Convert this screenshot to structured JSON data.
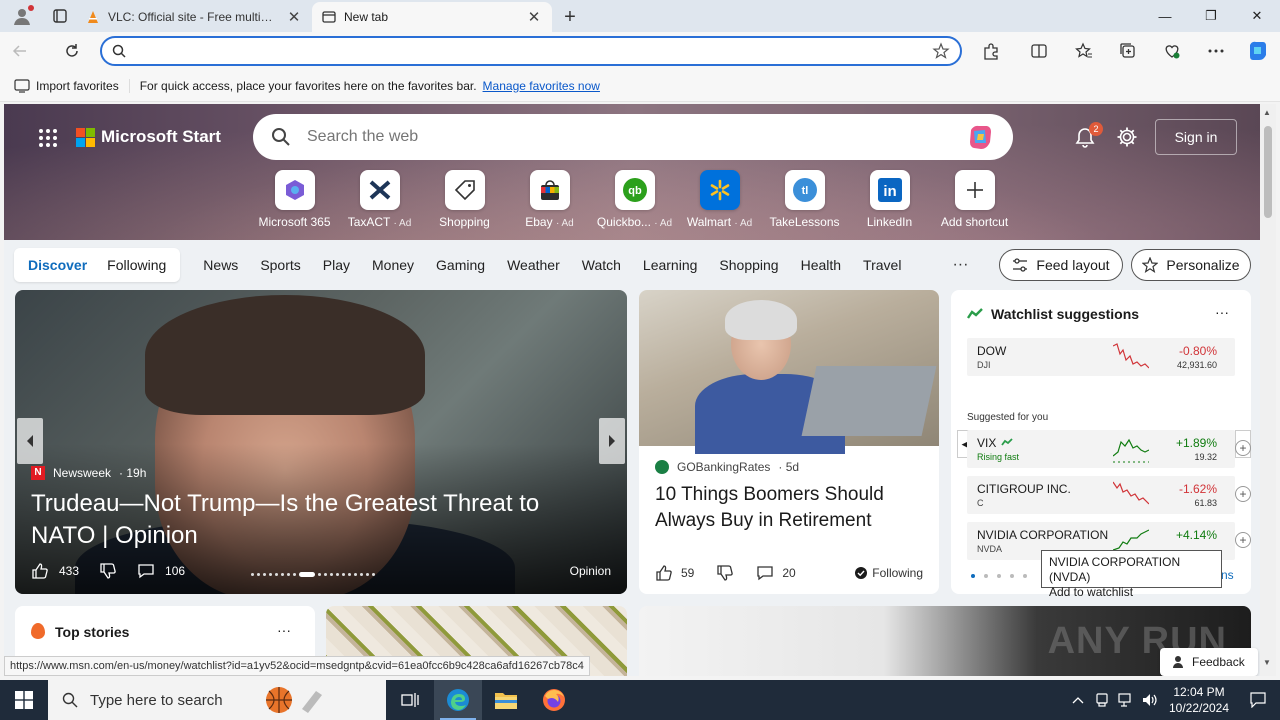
{
  "browser": {
    "tabs": [
      {
        "title": "VLC: Official site - Free multimedia solutions for all OS!",
        "close": "✕"
      },
      {
        "title": "New tab",
        "close": "✕"
      }
    ],
    "new_tab": "+",
    "address_placeholder": "",
    "window_controls": {
      "minimize": "—",
      "maximize": "❐",
      "close": "✕"
    }
  },
  "favorites_bar": {
    "import_label": "Import favorites",
    "message": "For quick access, place your favorites here on the favorites bar.",
    "link": "Manage favorites now"
  },
  "msstart": {
    "brand": "Microsoft Start",
    "search_placeholder": "Search the web",
    "notification_count": "2",
    "sign_in": "Sign in",
    "shortcuts": [
      {
        "label": "Microsoft 365",
        "ad": ""
      },
      {
        "label": "TaxACT",
        "ad": "· Ad"
      },
      {
        "label": "Shopping",
        "ad": ""
      },
      {
        "label": "Ebay",
        "ad": "· Ad"
      },
      {
        "label": "Quickbo...",
        "ad": "· Ad"
      },
      {
        "label": "Walmart",
        "ad": "· Ad"
      },
      {
        "label": "TakeLessons",
        "ad": ""
      },
      {
        "label": "LinkedIn",
        "ad": ""
      },
      {
        "label": "Add shortcut",
        "ad": ""
      }
    ]
  },
  "nav": {
    "pill": [
      "Discover",
      "Following"
    ],
    "categories": [
      "News",
      "Sports",
      "Play",
      "Money",
      "Gaming",
      "Weather",
      "Watch",
      "Learning",
      "Shopping",
      "Health",
      "Travel"
    ],
    "more": "···",
    "feed_layout": "Feed layout",
    "personalize": "Personalize"
  },
  "main_story": {
    "source": "Newsweek",
    "age": "· 19h",
    "headline": "Trudeau—Not Trump—Is the Greatest Threat to NATO | Opinion",
    "likes": "433",
    "comments": "106",
    "tag": "Opinion"
  },
  "story2": {
    "source": "GOBankingRates",
    "age": "· 5d",
    "headline": "10 Things Boomers Should Always Buy in Retirement",
    "likes": "59",
    "comments": "20",
    "following": "Following"
  },
  "watchlist": {
    "title": "Watchlist suggestions",
    "more": "···",
    "suggested_label": "Suggested for you",
    "stocks": [
      {
        "name": "DOW",
        "symbol": "DJI",
        "change": "-0.80%",
        "value": "42,931.60",
        "direction": "down"
      },
      {
        "name": "VIX",
        "symbol": "Rising fast",
        "change": "+1.89%",
        "value": "19.32",
        "direction": "up"
      },
      {
        "name": "CITIGROUP INC.",
        "symbol": "C",
        "change": "-1.62%",
        "value": "61.83",
        "direction": "down"
      },
      {
        "name": "NVIDIA CORPORATION",
        "symbol": "NVDA",
        "change": "+4.14%",
        "value": "",
        "direction": "up"
      }
    ],
    "tooltip_line1": "NVIDIA CORPORATION (NVDA)",
    "tooltip_line2": "Add to watchlist",
    "partial_text": "ns"
  },
  "top_stories": {
    "title": "Top stories",
    "more": "···"
  },
  "watermark": "ANY RUN",
  "feedback": "Feedback",
  "status_url": "https://www.msn.com/en-us/money/watchlist?id=a1yv52&ocid=msedgntp&cvid=61ea0fcc6b9c428ca6afd16267cb78c4",
  "taskbar": {
    "search_placeholder": "Type here to search",
    "time": "12:04 PM",
    "date": "10/22/2024"
  },
  "colors": {
    "accent": "#0f6cbd",
    "down": "#d13438",
    "up": "#107c10"
  }
}
